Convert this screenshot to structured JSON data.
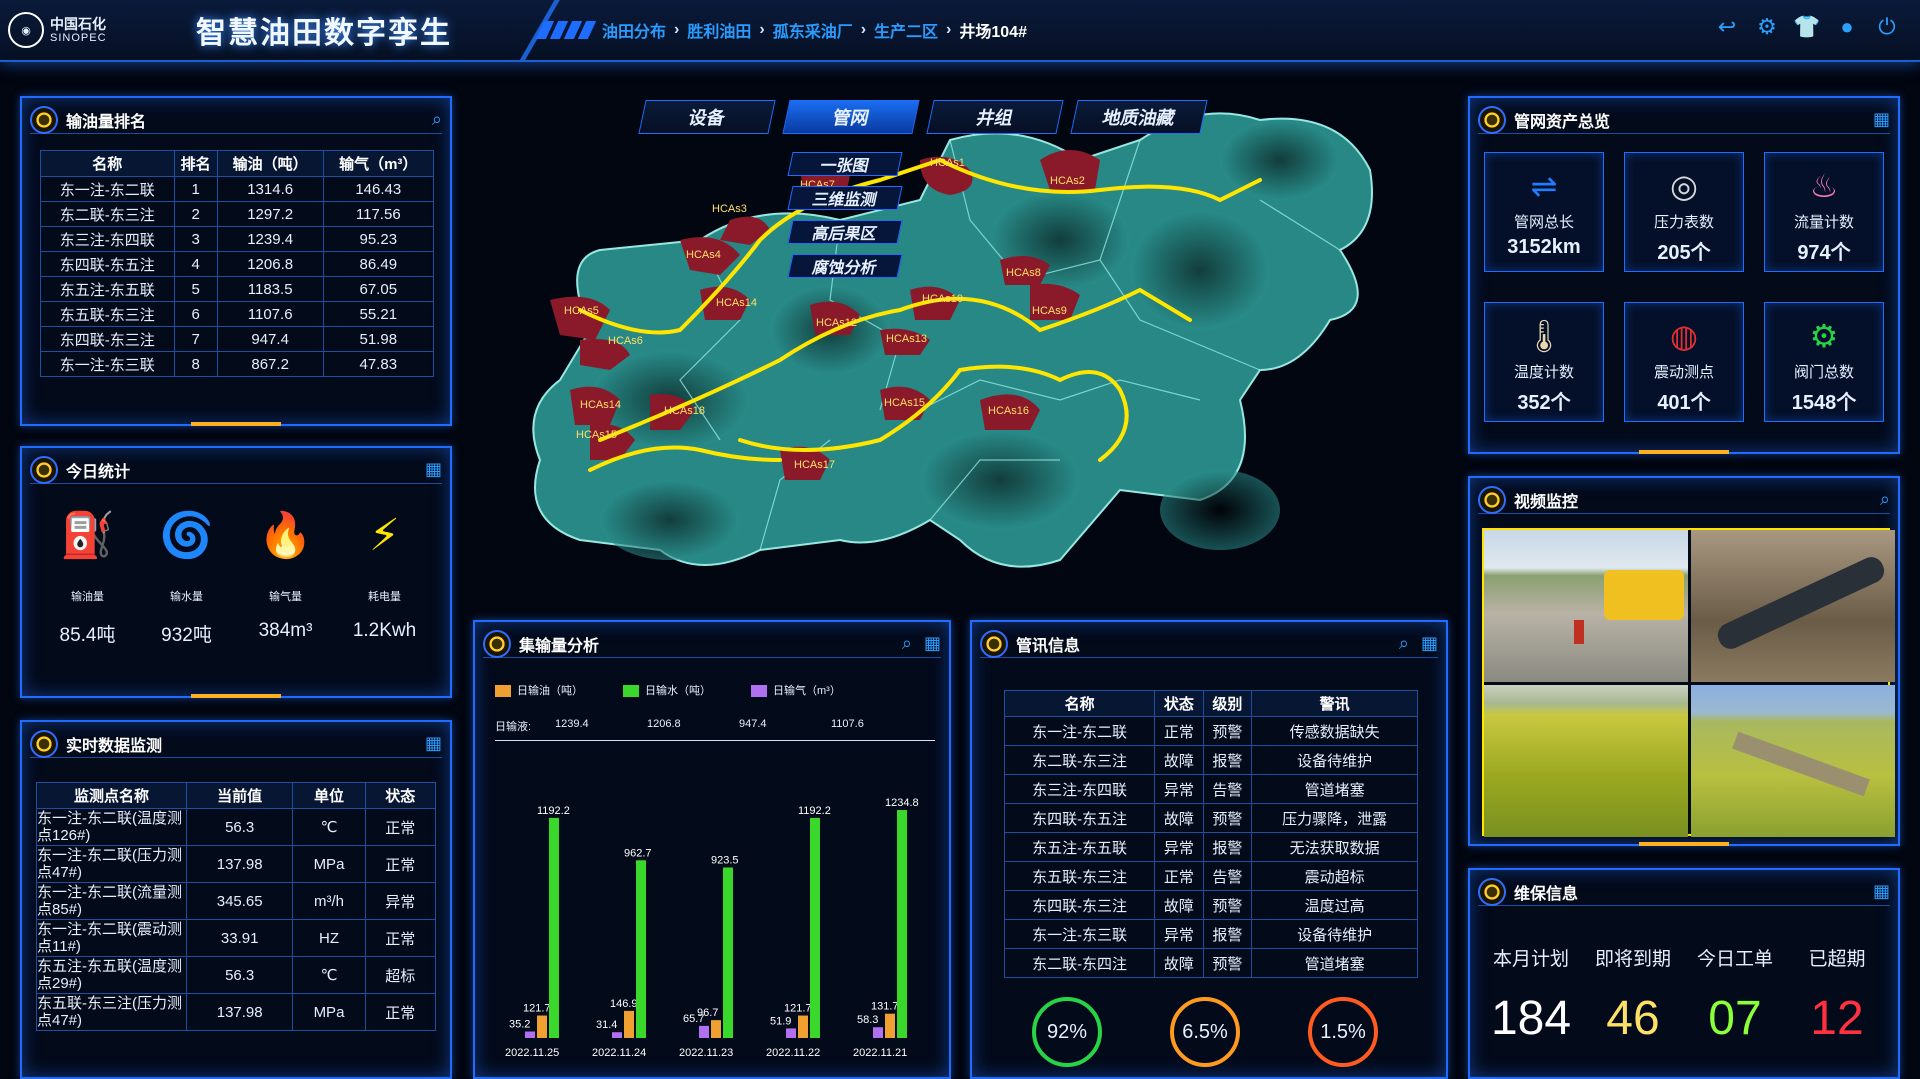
{
  "header": {
    "logo_cn": "中国石化",
    "logo_en": "SINOPEC",
    "app_title": "智慧油田数字孪生",
    "breadcrumb": [
      "油田分布",
      "胜利油田",
      "孤东采油厂",
      "生产二区",
      "井场104#"
    ]
  },
  "top_icons": [
    "back-icon",
    "gear-icon",
    "shirt-icon",
    "user-icon",
    "power-icon"
  ],
  "oil_rank": {
    "title": "输油量排名",
    "columns": [
      "名称",
      "排名",
      "输油（吨）",
      "输气（m³）"
    ],
    "rows": [
      [
        "东一注-东二联",
        "1",
        "1314.6",
        "146.43"
      ],
      [
        "东二联-东三注",
        "2",
        "1297.2",
        "117.56"
      ],
      [
        "东三注-东四联",
        "3",
        "1239.4",
        "95.23"
      ],
      [
        "东四联-东五注",
        "4",
        "1206.8",
        "86.49"
      ],
      [
        "东五注-东五联",
        "5",
        "1183.5",
        "67.05"
      ],
      [
        "东五联-东三注",
        "6",
        "1107.6",
        "55.21"
      ],
      [
        "东四联-东三注",
        "7",
        "947.4",
        "51.98"
      ],
      [
        "东一注-东三联",
        "8",
        "867.2",
        "47.83"
      ]
    ]
  },
  "today": {
    "title": "今日统计",
    "items": [
      {
        "label": "输油量",
        "value": "85.4吨",
        "color": "#c9c98a"
      },
      {
        "label": "输水量",
        "value": "932吨",
        "color": "#1f7dff"
      },
      {
        "label": "输气量",
        "value": "384m³",
        "color": "#ff7ab8"
      },
      {
        "label": "耗电量",
        "value": "1.2Kwh",
        "color": "#ffe400"
      }
    ]
  },
  "realtime": {
    "title": "实时数据监测",
    "columns": [
      "监测点名称",
      "当前值",
      "单位",
      "状态"
    ],
    "rows": [
      [
        "东一注-东二联(温度测点126#)",
        "56.3",
        "℃",
        "正常"
      ],
      [
        "东一注-东二联(压力测点47#)",
        "137.98",
        "MPa",
        "正常"
      ],
      [
        "东一注-东二联(流量测点85#)",
        "345.65",
        "m³/h",
        "异常"
      ],
      [
        "东一注-东二联(震动测点11#)",
        "33.91",
        "HZ",
        "正常"
      ],
      [
        "东五注-东五联(温度测点29#)",
        "56.3",
        "℃",
        "超标"
      ],
      [
        "东五联-东三注(压力测点47#)",
        "137.98",
        "MPa",
        "正常"
      ]
    ]
  },
  "map": {
    "tabs": [
      "设备",
      "管网",
      "井组",
      "地质油藏"
    ],
    "active_tab": "管网",
    "subtabs": [
      "一张图",
      "三维监测",
      "高后果区",
      "腐蚀分析"
    ],
    "zones": [
      "HCAs1",
      "HCAs2",
      "HCAs3",
      "HCAs4",
      "HCAs5",
      "HCAs6",
      "HCAs7",
      "HCAs8",
      "HCAs9",
      "HCAs10",
      "HCAs12",
      "HCAs13",
      "HCAs14",
      "HCAs14",
      "HCAs15",
      "HCAs15",
      "HCAs16",
      "HCAs17",
      "HCAs18"
    ]
  },
  "gather": {
    "title": "集输量分析",
    "legend": [
      "日输油（吨）",
      "日输水（吨）",
      "日输气（m³）"
    ],
    "liquid_label": "日输液:",
    "liquid_values": [
      "1239.4",
      "1206.8",
      "947.4",
      "1107.6"
    ]
  },
  "chart_data": {
    "type": "bar",
    "categories": [
      "2022.11.25",
      "2022.11.24",
      "2022.11.23",
      "2022.11.22",
      "2022.11.21"
    ],
    "series": [
      {
        "name": "日输油（吨）",
        "values": [
          121.7,
          146.9,
          96.7,
          121.7,
          131.7
        ],
        "color": "#f0a030"
      },
      {
        "name": "日输水（吨）",
        "values": [
          1192.2,
          962.7,
          923.5,
          1192.2,
          1234.8
        ],
        "color": "#3ad82a"
      },
      {
        "name": "日输气（m³）",
        "values": [
          35.2,
          31.4,
          65.7,
          51.9,
          58.3
        ],
        "color": "#b070f0"
      }
    ]
  },
  "alerts": {
    "title": "管讯信息",
    "columns": [
      "名称",
      "状态",
      "级别",
      "警讯"
    ],
    "rows": [
      [
        "东一注-东二联",
        "正常",
        "预警",
        "传感数据缺失"
      ],
      [
        "东二联-东三注",
        "故障",
        "报警",
        "设备待维护"
      ],
      [
        "东三注-东四联",
        "异常",
        "告警",
        "管道堵塞"
      ],
      [
        "东四联-东五注",
        "故障",
        "预警",
        "压力骤降，泄露"
      ],
      [
        "东五注-东五联",
        "异常",
        "报警",
        "无法获取数据"
      ],
      [
        "东五联-东三注",
        "正常",
        "告警",
        "震动超标"
      ],
      [
        "东四联-东三注",
        "故障",
        "预警",
        "温度过高"
      ],
      [
        "东一注-东三联",
        "异常",
        "报警",
        "设备待维护"
      ],
      [
        "东二联-东四注",
        "故障",
        "预警",
        "管道堵塞"
      ]
    ],
    "rings": [
      {
        "value": "92%",
        "color": "#27d447"
      },
      {
        "value": "6.5%",
        "color": "#ff9a20"
      },
      {
        "value": "1.5%",
        "color": "#ff5a20"
      }
    ]
  },
  "assets": {
    "title": "管网资产总览",
    "items": [
      {
        "label": "管网总长",
        "value": "3152km",
        "icon": "pipe-icon",
        "color": "#1f7dff"
      },
      {
        "label": "压力表数",
        "value": "205个",
        "icon": "gauge-icon",
        "color": "#d8d8d8"
      },
      {
        "label": "流量计数",
        "value": "974个",
        "icon": "flow-meter-icon",
        "color": "#ff7ab8"
      },
      {
        "label": "温度计数",
        "value": "352个",
        "icon": "thermometer-icon",
        "color": "#e8d8b0"
      },
      {
        "label": "震动测点",
        "value": "401个",
        "icon": "vibration-icon",
        "color": "#e03030"
      },
      {
        "label": "阀门总数",
        "value": "1548个",
        "icon": "valve-icon",
        "color": "#27d447"
      }
    ]
  },
  "video": {
    "title": "视频监控"
  },
  "maintenance": {
    "title": "维保信息",
    "items": [
      {
        "label": "本月计划",
        "value": "184",
        "color": "#ffffff"
      },
      {
        "label": "即将到期",
        "value": "46",
        "color": "#ffe066"
      },
      {
        "label": "今日工单",
        "value": "07",
        "color": "#8cff3a"
      },
      {
        "label": "已超期",
        "value": "12",
        "color": "#ff3040"
      }
    ]
  }
}
